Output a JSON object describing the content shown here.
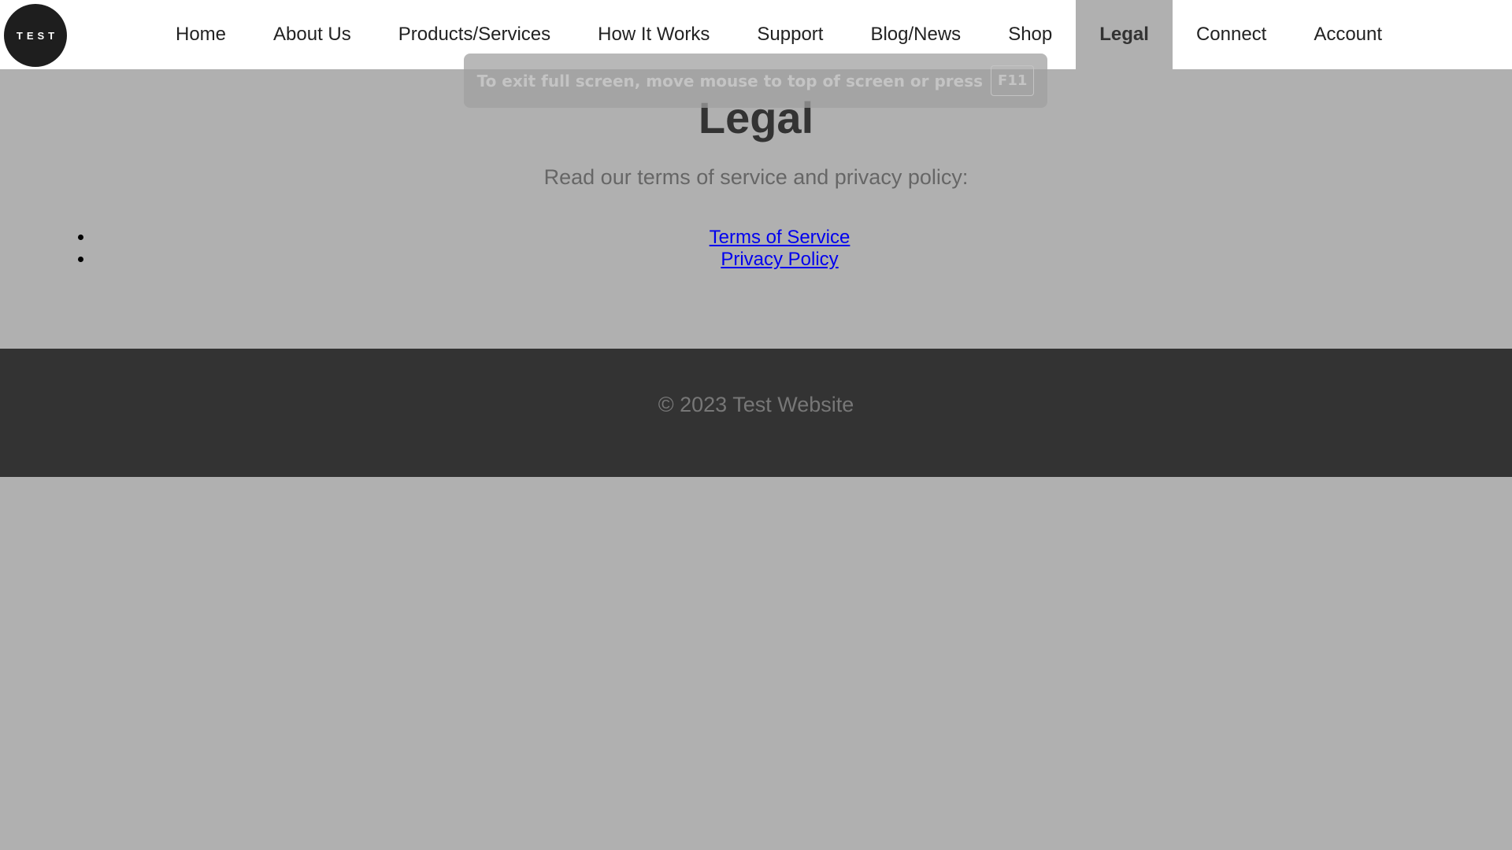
{
  "logo": {
    "text": "TEST"
  },
  "nav": {
    "items": [
      {
        "label": "Home"
      },
      {
        "label": "About Us"
      },
      {
        "label": "Products/Services"
      },
      {
        "label": "How It Works"
      },
      {
        "label": "Support"
      },
      {
        "label": "Blog/News"
      },
      {
        "label": "Shop"
      },
      {
        "label": "Legal",
        "active": true
      },
      {
        "label": "Connect"
      },
      {
        "label": "Account"
      }
    ]
  },
  "main": {
    "title": "Legal",
    "intro": "Read our terms of service and privacy policy:",
    "links": [
      {
        "label": "Terms of Service"
      },
      {
        "label": "Privacy Policy"
      }
    ]
  },
  "footer": {
    "text": "© 2023 Test Website"
  },
  "fullscreen_notice": {
    "text": "To exit full screen, move mouse to top of screen or press",
    "key": "F11"
  },
  "colors": {
    "page_background": "#b0b0b0",
    "navbar_background": "#ffffff",
    "footer_background": "#333333",
    "link": "#0000ee"
  }
}
